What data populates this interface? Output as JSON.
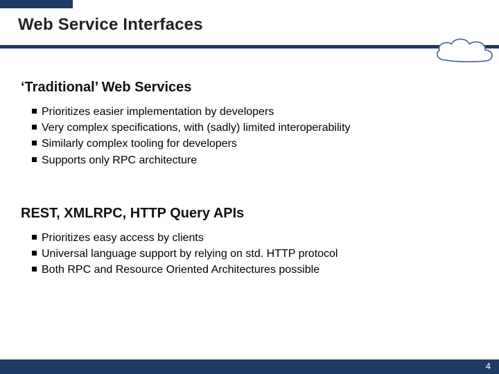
{
  "title": "Web Service Interfaces",
  "sections": [
    {
      "heading": "‘Traditional’ Web Services",
      "bullets": [
        "Prioritizes easier implementation by developers",
        "Very complex specifications, with (sadly) limited interoperability",
        "Similarly complex tooling for developers",
        "Supports only RPC architecture"
      ]
    },
    {
      "heading": "REST, XMLRPC, HTTP Query APIs",
      "bullets": [
        "Prioritizes easy access by clients",
        "Universal language support by relying on std. HTTP protocol",
        "Both RPC and Resource Oriented Architectures possible"
      ]
    }
  ],
  "page_number": "4"
}
